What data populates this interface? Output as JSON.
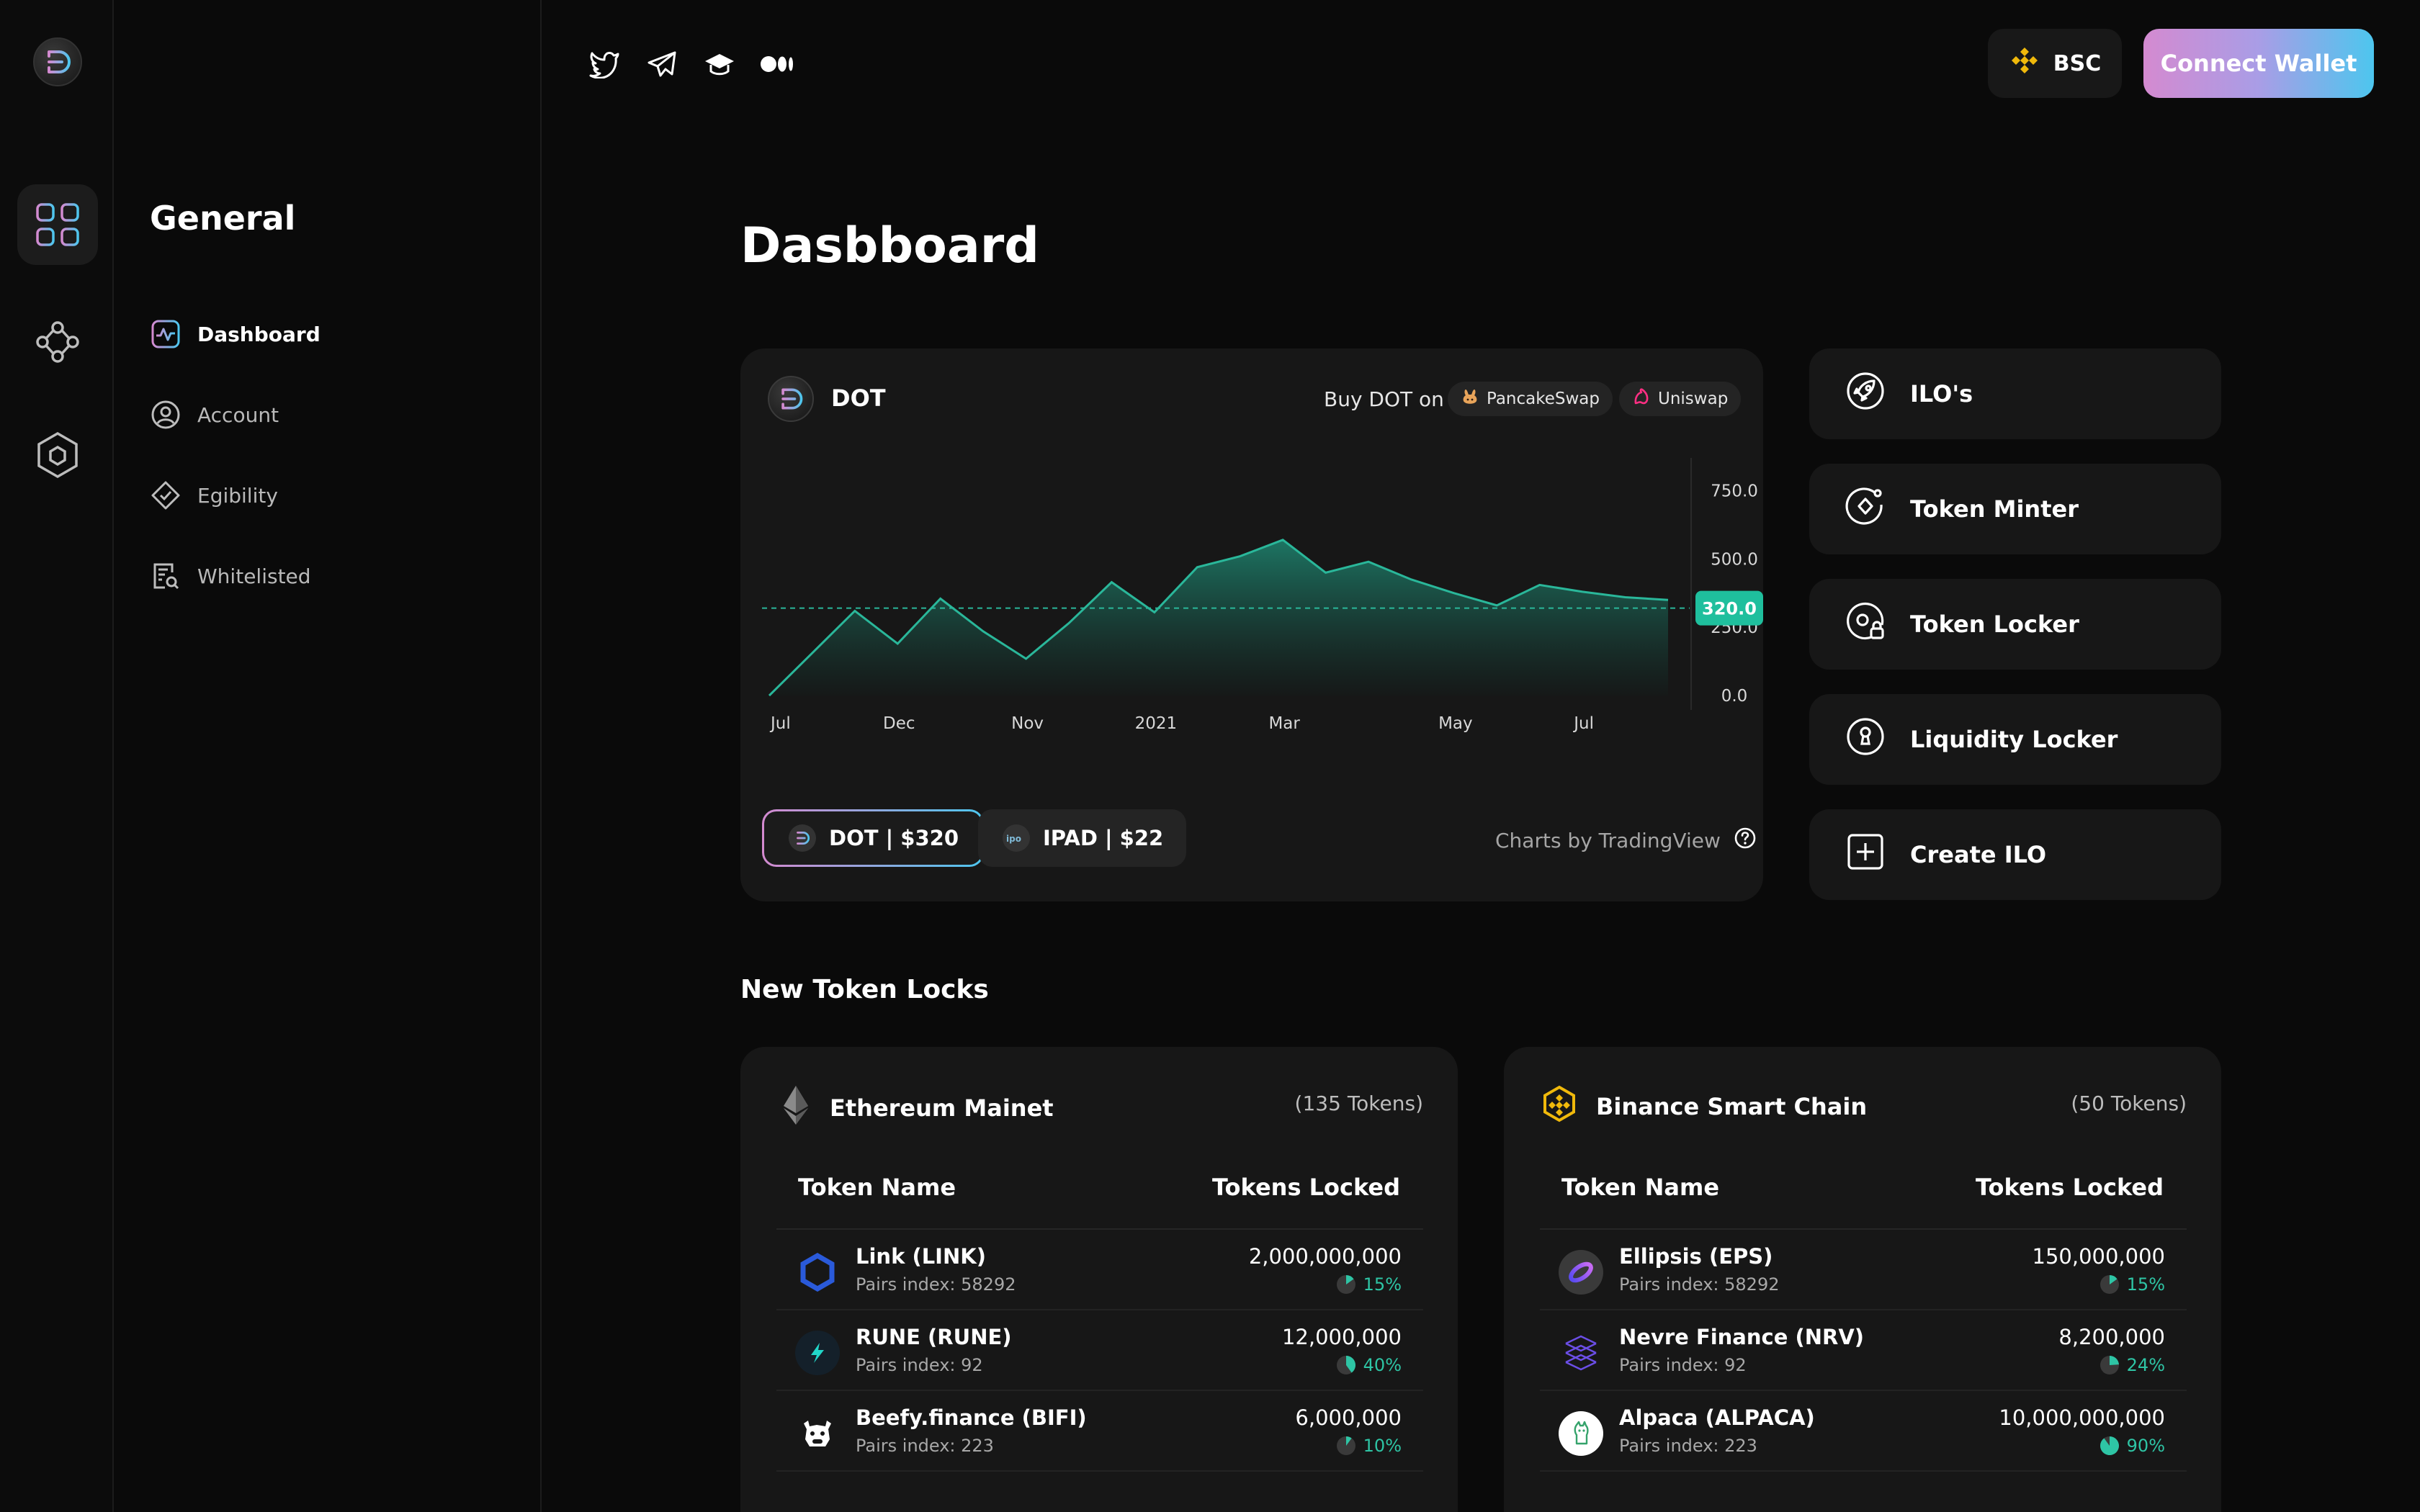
{
  "header": {
    "network_label": "BSC",
    "connect_label": "Connect Wallet"
  },
  "sidebar": {
    "title": "General",
    "items": [
      {
        "label": "Dashboard",
        "active": true
      },
      {
        "label": "Account"
      },
      {
        "label": "Egibility"
      },
      {
        "label": "Whitelisted"
      }
    ]
  },
  "main": {
    "title": "Dasbboard",
    "chart": {
      "coin": "DOT",
      "buy_label": "Buy DOT on",
      "dex": [
        "PancakeSwap",
        "Uniswap"
      ],
      "pills": [
        "DOT | $320",
        "IPAD | $22"
      ],
      "credit": "Charts by TradingView"
    },
    "actions": [
      "ILO's",
      "Token Minter",
      "Token Locker",
      "Liquidity Locker",
      "Create ILO"
    ],
    "locks_title": "New Token Locks",
    "col_name": "Token Name",
    "col_locked": "Tokens Locked",
    "eth": {
      "name": "Ethereum Mainet",
      "count": "(135 Tokens)",
      "rows": [
        {
          "name": "Link (LINK)",
          "pairs": "Pairs index: 58292",
          "amount": "2,000,000,000",
          "pct": "15%",
          "pct_value": 15
        },
        {
          "name": "RUNE (RUNE)",
          "pairs": "Pairs index: 92",
          "amount": "12,000,000",
          "pct": "40%",
          "pct_value": 40
        },
        {
          "name": "Beefy.finance (BIFI)",
          "pairs": "Pairs index: 223",
          "amount": "6,000,000",
          "pct": "10%",
          "pct_value": 10
        }
      ]
    },
    "bsc": {
      "name": "Binance Smart Chain",
      "count": "(50 Tokens)",
      "rows": [
        {
          "name": "Ellipsis (EPS)",
          "pairs": "Pairs index: 58292",
          "amount": "150,000,000",
          "pct": "15%",
          "pct_value": 15
        },
        {
          "name": "Nevre Finance (NRV)",
          "pairs": "Pairs index: 92",
          "amount": "8,200,000",
          "pct": "24%",
          "pct_value": 24
        },
        {
          "name": "Alpaca (ALPACA)",
          "pairs": "Pairs index: 223",
          "amount": "10,000,000,000",
          "pct": "90%",
          "pct_value": 90
        }
      ]
    }
  },
  "chart_data": {
    "type": "area",
    "x": [
      "Jul",
      "",
      "",
      "Dec",
      "",
      "",
      "Nov",
      "",
      "",
      "2021",
      "",
      "",
      "Mar",
      "",
      "",
      "",
      "May",
      "",
      "",
      "Jul",
      "",
      ""
    ],
    "x_ticks": [
      "Jul",
      "Dec",
      "Nov",
      "2021",
      "Mar",
      "May",
      "Jul"
    ],
    "y_ticks": [
      "750.0",
      "500.0",
      "250.0",
      "0.0"
    ],
    "values": [
      0,
      155,
      310,
      190,
      355,
      235,
      135,
      265,
      415,
      305,
      470,
      510,
      570,
      450,
      490,
      425,
      375,
      330,
      405,
      380,
      360,
      350
    ],
    "current_label": "320.0",
    "current_value": 320,
    "ylim": [
      -100,
      870
    ],
    "colors": {
      "line": "#2ab79a",
      "fill_top": "#1d7a67",
      "fill_bottom": "#151a19",
      "marker": "#1fbf9d"
    }
  }
}
